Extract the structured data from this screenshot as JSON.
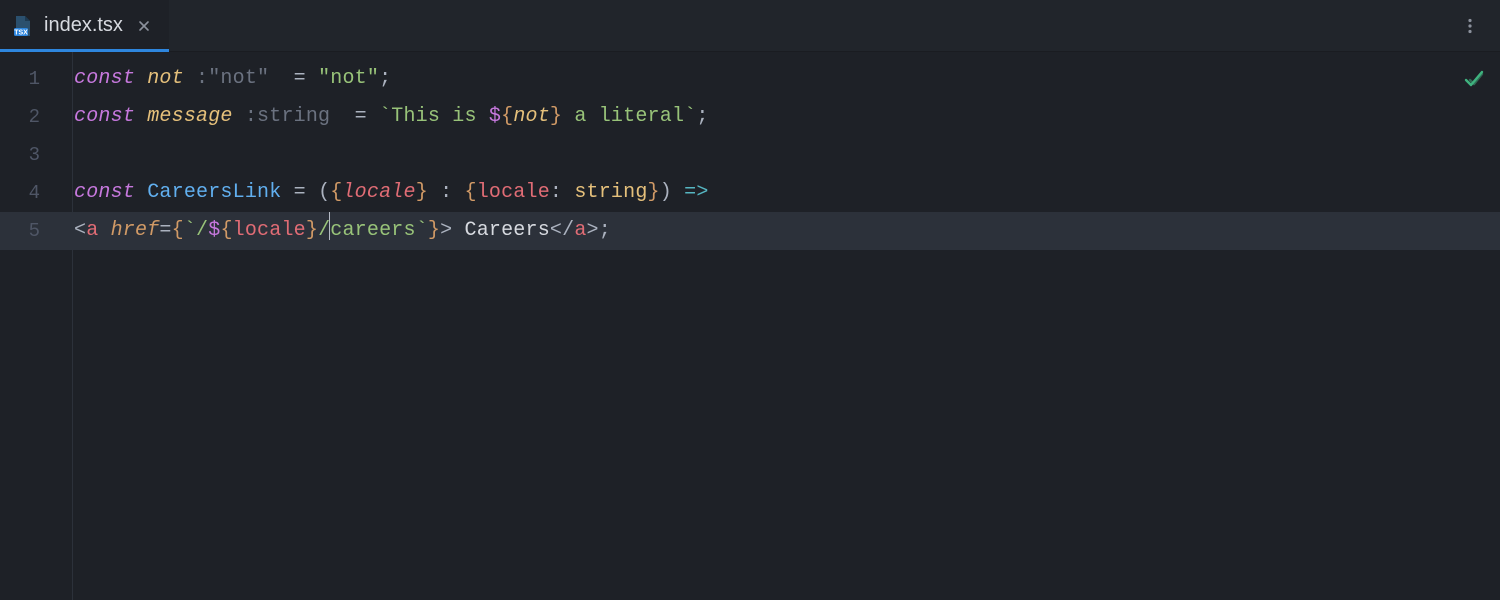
{
  "tab": {
    "filename": "index.tsx",
    "icon": "tsx-file-icon"
  },
  "status": {
    "check": "no-problems"
  },
  "gutter": {
    "line_numbers": [
      "1",
      "2",
      "3",
      "4",
      "5"
    ]
  },
  "code": {
    "line1": {
      "kw_const": "const",
      "var_not": "not",
      "hint_colon": " :",
      "hint_type": "\"not\"",
      "equals": " = ",
      "str_open": "\"",
      "str_val": "not",
      "str_close": "\"",
      "semi": ";"
    },
    "line2": {
      "kw_const": "const",
      "var_message": "message",
      "hint_colon": " :",
      "hint_type": "string",
      "equals": " = ",
      "backtick_open": "`",
      "str_a": "This is ",
      "dollar": "$",
      "brace_open": "{",
      "interp_var": "not",
      "brace_close": "}",
      "str_b": " a literal",
      "backtick_close": "`",
      "semi": ";"
    },
    "line4": {
      "kw_const": "const",
      "fn_name": "CareersLink",
      "eq": " = ",
      "paren_open": "(",
      "brace_open": "{",
      "param": "locale",
      "brace_close": "}",
      "colon": " : ",
      "tbrace_open": "{",
      "tkey": "locale",
      "tcolon": ": ",
      "ttype": "string",
      "tbrace_close": "}",
      "paren_close": ")",
      "arrow": " =>"
    },
    "line5": {
      "lt1": "<",
      "tag_a1": "a",
      "sp1": " ",
      "attr_href": "href",
      "eq": "=",
      "jsx_open": "{",
      "backtick_open": "`",
      "str_slash1": "/",
      "dollar": "$",
      "ibrace_open": "{",
      "interp_var": "locale",
      "ibrace_close": "}",
      "str_slash2": "/",
      "str_careers": "careers",
      "backtick_close": "`",
      "jsx_close": "}",
      "gt1": ">",
      "text": " Careers",
      "lt2": "</",
      "tag_a2": "a",
      "gt2": ">",
      "semi": ";"
    }
  },
  "active_line_index": 4,
  "colors": {
    "bg": "#1e2127",
    "tabbar": "#21252b",
    "accent": "#2e86de",
    "gutter": "#4f5666",
    "active_line": "#2c313a",
    "string": "#98c379",
    "keyword": "#c678dd",
    "variable": "#e5c07b",
    "function": "#61afef",
    "tag": "#e06c75",
    "attr": "#d19a66",
    "hint": "#6b7280",
    "check": "#3fb37f"
  }
}
